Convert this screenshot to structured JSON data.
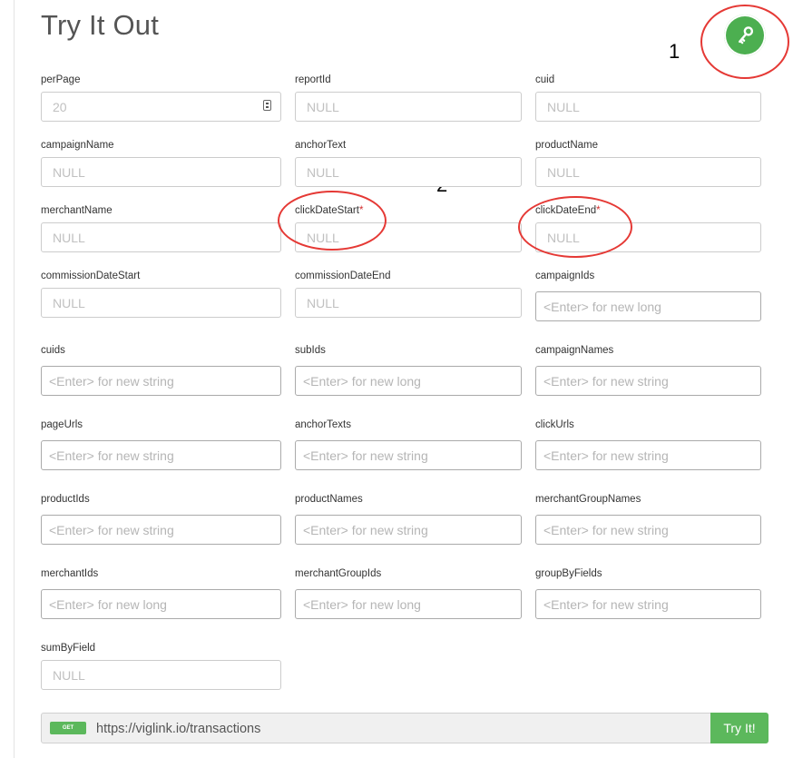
{
  "header": {
    "title": "Try It Out"
  },
  "annotations": {
    "one": "1",
    "two": "2"
  },
  "colors": {
    "accent": "#4caf50",
    "annotation": "#e53935",
    "required": "#d32f2f",
    "get_badge": "#5cb85c"
  },
  "fields": [
    {
      "label": "perPage",
      "placeholder": "20",
      "required": false
    },
    {
      "label": "reportId",
      "placeholder": "NULL",
      "required": false
    },
    {
      "label": "cuid",
      "placeholder": "NULL",
      "required": false
    },
    {
      "label": "campaignName",
      "placeholder": "NULL",
      "required": false
    },
    {
      "label": "anchorText",
      "placeholder": "NULL",
      "required": false
    },
    {
      "label": "productName",
      "placeholder": "NULL",
      "required": false
    },
    {
      "label": "merchantName",
      "placeholder": "NULL",
      "required": false
    },
    {
      "label": "clickDateStart",
      "placeholder": "NULL",
      "required": true
    },
    {
      "label": "clickDateEnd",
      "placeholder": "NULL",
      "required": true
    },
    {
      "label": "commissionDateStart",
      "placeholder": "NULL",
      "required": false
    },
    {
      "label": "commissionDateEnd",
      "placeholder": "NULL",
      "required": false
    },
    {
      "label": "campaignIds",
      "placeholder": "<Enter> for new long",
      "required": false
    },
    {
      "label": "cuids",
      "placeholder": "<Enter> for new string",
      "required": false
    },
    {
      "label": "subIds",
      "placeholder": "<Enter> for new long",
      "required": false
    },
    {
      "label": "campaignNames",
      "placeholder": "<Enter> for new string",
      "required": false
    },
    {
      "label": "pageUrls",
      "placeholder": "<Enter> for new string",
      "required": false
    },
    {
      "label": "anchorTexts",
      "placeholder": "<Enter> for new string",
      "required": false
    },
    {
      "label": "clickUrls",
      "placeholder": "<Enter> for new string",
      "required": false
    },
    {
      "label": "productIds",
      "placeholder": "<Enter> for new string",
      "required": false
    },
    {
      "label": "productNames",
      "placeholder": "<Enter> for new string",
      "required": false
    },
    {
      "label": "merchantGroupNames",
      "placeholder": "<Enter> for new string",
      "required": false
    },
    {
      "label": "merchantIds",
      "placeholder": "<Enter> for new long",
      "required": false
    },
    {
      "label": "merchantGroupIds",
      "placeholder": "<Enter> for new long",
      "required": false
    },
    {
      "label": "groupByFields",
      "placeholder": "<Enter> for new string",
      "required": false
    },
    {
      "label": "sumByField",
      "placeholder": "NULL",
      "required": false
    }
  ],
  "request": {
    "method": "GET",
    "url": "https://viglink.io/transactions",
    "try_label": "Try It!"
  }
}
